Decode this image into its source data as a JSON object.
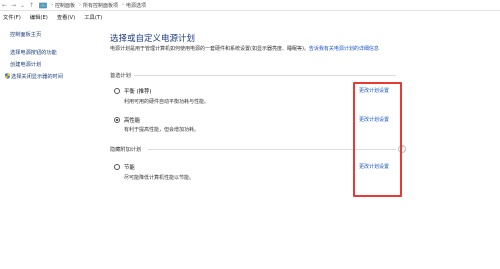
{
  "address": {
    "crumbs": [
      "控制面板",
      "所有控制面板项",
      "电源选项"
    ]
  },
  "menu": {
    "file": "文件(F)",
    "edit": "编辑(E)",
    "view": "查看(V)",
    "tools": "工具(T)"
  },
  "left": {
    "items": [
      "控制面板主页",
      "选择电源按钮的功能",
      "创建电源计划",
      "选择关闭显示器的时间"
    ]
  },
  "main": {
    "title": "选择或自定义电源计划",
    "desc_text": "电源计划是用于管理计算机如何使用电源的一套硬件和系统设置(如显示器亮度、睡眠等)。",
    "desc_link": "告诉我有关电源计划的详细信息",
    "preferred_header": "首选计划",
    "hidden_header": "隐藏附加计划",
    "plans": [
      {
        "name": "平衡 (推荐)",
        "desc": "利用可用的硬件自动平衡功耗与性能。",
        "link": "更改计划设置",
        "selected": false
      },
      {
        "name": "高性能",
        "desc": "有利于提高性能，但会增加功耗。",
        "link": "更改计划设置",
        "selected": true
      },
      {
        "name": "节能",
        "desc": "尽可能降低计算机性能以节能。",
        "link": "更改计划设置",
        "selected": false
      }
    ]
  },
  "colors": {
    "highlight": "#e53a36",
    "link": "#1a56c8",
    "title": "#1f3d80"
  },
  "icons": {
    "back": "arrow-left-icon",
    "forward": "arrow-right-icon",
    "up": "arrow-up-icon",
    "location": "control-panel-icon",
    "shield": "shield-icon",
    "collapse": "chevron-up-icon"
  }
}
